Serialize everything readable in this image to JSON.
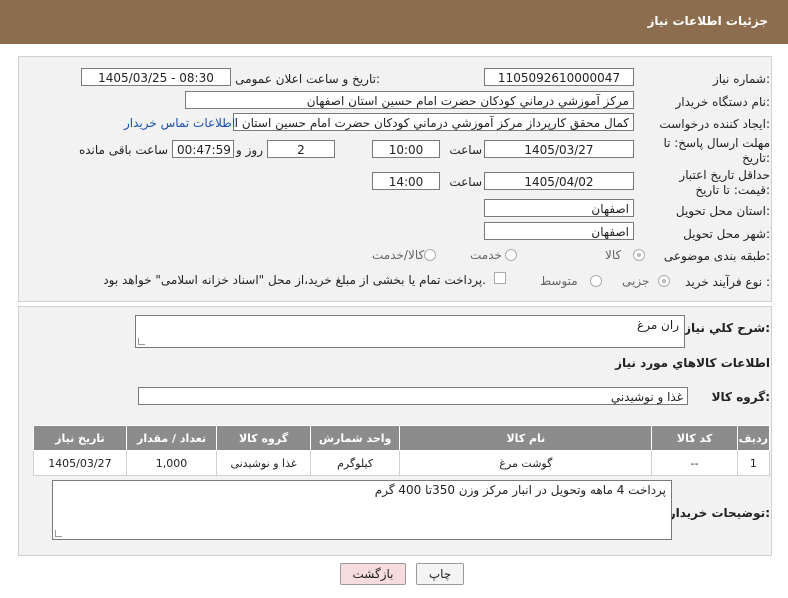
{
  "header": {
    "title": "جزئیات اطلاعات نیاز"
  },
  "form": {
    "need_number_label": "شماره نیاز:",
    "need_number": "1105092610000047",
    "announce_label": "تاریخ و ساعت اعلان عمومی:",
    "announce_value": "1405/03/25 - 08:30",
    "buyer_org_label": "نام دستگاه خریدار:",
    "buyer_org": "مرکز آموزشي درماني کودکان حضرت امام حسين استان اصفهان",
    "creator_label": "ایجاد کننده درخواست:",
    "creator": "کمال محقق کارپرداز مرکز آموزشي درماني کودکان حضرت امام حسين استان اصفهان",
    "contact_link": "اطلاعات تماس خریدار",
    "deadline_label": "مهلت ارسال پاسخ: تا تاریخ:",
    "deadline_date": "1405/03/27",
    "time_label": "ساعت",
    "deadline_time": "10:00",
    "days_value": "2",
    "days_label": "روز و",
    "remaining_time": "00:47:59",
    "remaining_label": "ساعت باقی مانده",
    "price_valid_label": "حداقل تاریخ اعتبار قیمت: تا تاریخ:",
    "price_valid_date": "1405/04/02",
    "price_valid_time": "14:00",
    "province_label": "استان محل تحویل:",
    "province": "اصفهان",
    "city_label": "شهر محل تحویل:",
    "city": "اصفهان",
    "category_label": "طبقه بندی موضوعی:",
    "category_options": {
      "goods": "کالا",
      "service": "خدمت",
      "goods_service": "کالا/خدمت"
    },
    "process_label": "نوع فرآیند خرید :",
    "process_options": {
      "minor": "جزیی",
      "medium": "متوسط"
    },
    "payment_note": "پرداخت تمام یا بخشی از مبلغ خرید،از محل \"اسناد خزانه اسلامی\" خواهد بود."
  },
  "summary": {
    "label": "شرح کلي نياز:",
    "value": "ران مرغ"
  },
  "goods_section": {
    "title": "اطلاعات کالاهاي مورد نياز",
    "group_label": "گروه کالا:",
    "group_value": "غذا و نوشيدني"
  },
  "table": {
    "headers": [
      "ردیف",
      "کد کالا",
      "نام کالا",
      "واحد شمارش",
      "گروه کالا",
      "تعداد / مقدار",
      "تاریخ نیاز"
    ],
    "rows": [
      [
        "1",
        "--",
        "گوشت مرغ",
        "کیلوگرم",
        "غذا و نوشیدنی",
        "1,000",
        "1405/03/27"
      ]
    ]
  },
  "buyer_notes": {
    "label": "توضیحات خریدار:",
    "value": "پرداخت 4 ماهه وتحویل در انبار مرکز  وزن 350تا 400 گرم"
  },
  "buttons": {
    "print": "چاپ",
    "back": "بازگشت"
  },
  "colors": {
    "header_bg": "#8c6d4d",
    "table_header_bg": "#8c8c8c",
    "back_button_bg": "#f6dcdc"
  }
}
